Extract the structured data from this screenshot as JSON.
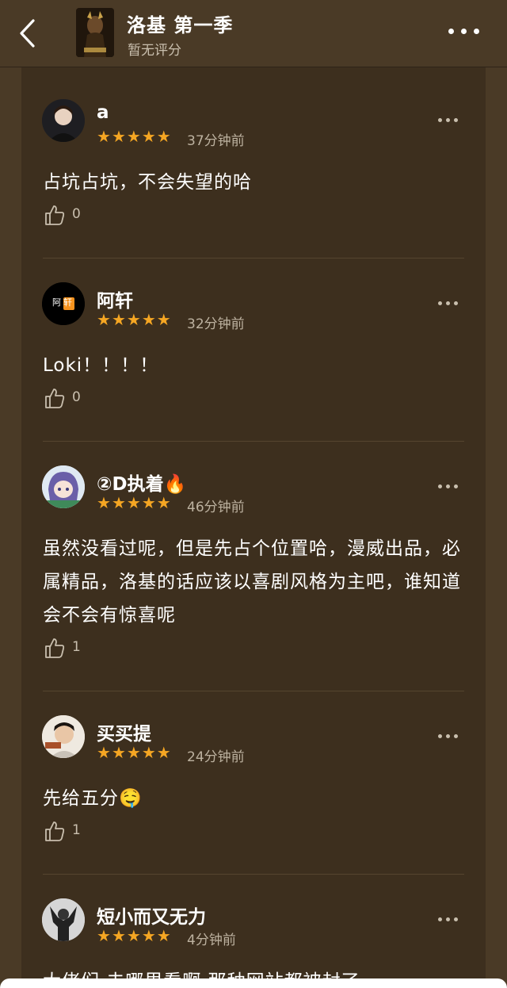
{
  "header": {
    "title": "洛基 第一季",
    "subtitle": "暂无评分",
    "back_icon": "chevron-left-icon",
    "more_icon": "more-dots-icon"
  },
  "colors": {
    "background": "#4a3a26",
    "card": "#3d2f1e",
    "star": "#f5a623",
    "muted_text": "#bdb2a0"
  },
  "comments": [
    {
      "username": "a",
      "rating": 5,
      "time": "37分钟前",
      "text": "占坑占坑，不会失望的哈",
      "likes": "0"
    },
    {
      "username": "阿轩",
      "avatar_text": "阿轩",
      "rating": 5,
      "time": "32分钟前",
      "text": "Loki！！！！",
      "likes": "0"
    },
    {
      "username": "②D执着🔥",
      "rating": 5,
      "time": "46分钟前",
      "text": "虽然没看过呢，但是先占个位置哈，漫威出品，必属精品，洛基的话应该以喜剧风格为主吧，谁知道会不会有惊喜呢",
      "likes": "1"
    },
    {
      "username": "买买提",
      "rating": 5,
      "time": "24分钟前",
      "text": "先给五分🤤",
      "likes": "1"
    },
    {
      "username": "短小而又无力",
      "rating": 5,
      "time": "4分钟前",
      "text": "大佬们 去哪里看啊 那种网站都被封了",
      "likes": ""
    }
  ]
}
